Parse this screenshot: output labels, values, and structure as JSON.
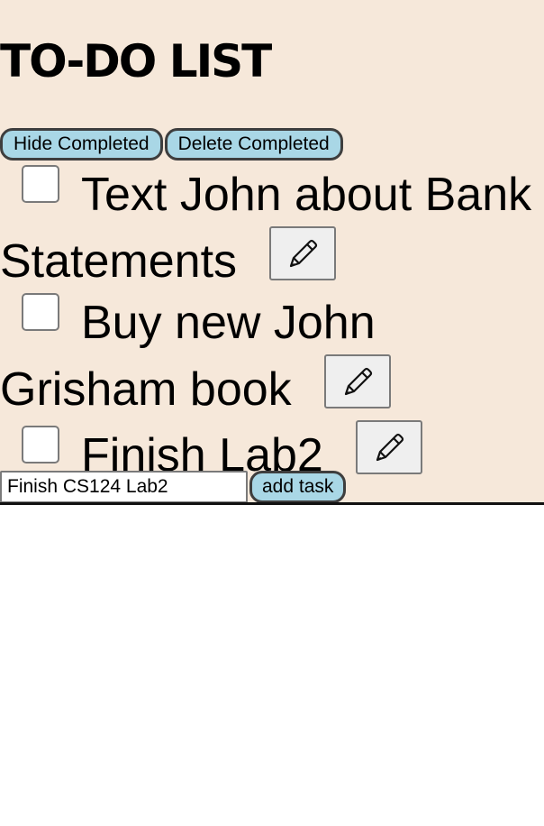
{
  "header": {
    "title": "TO-DO LIST"
  },
  "controls": {
    "hide_completed_label": "Hide Completed",
    "delete_completed_label": "Delete Completed"
  },
  "tasks": [
    {
      "text": "Text John about Bank Statements",
      "completed": false,
      "edit_icon": "pencil-icon"
    },
    {
      "text": "Buy new John Grisham book",
      "completed": false,
      "edit_icon": "pencil-icon"
    },
    {
      "text": "Finish Lab2",
      "completed": false,
      "edit_icon": "pencil-icon"
    }
  ],
  "new_task": {
    "value": "Finish CS124 Lab2",
    "add_label": "add task"
  },
  "colors": {
    "panel_background": "#f6e8da",
    "button_background": "#a9d7e6",
    "button_border": "#3e3e3e",
    "edit_button_background": "#efefef"
  }
}
